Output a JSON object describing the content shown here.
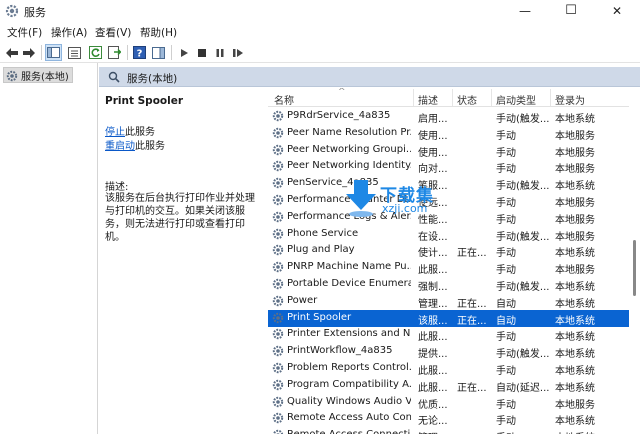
{
  "window": {
    "title": "服务",
    "minimize": "—",
    "maximize": "☐",
    "close": "✕"
  },
  "menu": [
    "文件(F)",
    "操作(A)",
    "查看(V)",
    "帮助(H)"
  ],
  "toolbar_icons": [
    "back-arrow-icon",
    "forward-arrow-icon",
    "show-console-tree-icon",
    "properties-icon",
    "refresh-icon",
    "export-list-icon",
    "help-icon",
    "show-action-pane-icon",
    "start-service-icon",
    "stop-service-icon",
    "pause-service-icon",
    "restart-service-icon"
  ],
  "tree": {
    "root_label": "服务(本地)"
  },
  "pane_header": {
    "title": "服务(本地)"
  },
  "details": {
    "service_name": "Print Spooler",
    "stop_link": "停止",
    "stop_suffix": "此服务",
    "restart_link": "重启动",
    "restart_suffix": "此服务",
    "desc_label": "描述:",
    "description": "该服务在后台执行打印作业并处理与打印机的交互。如果关闭该服务，则无法进行打印或查看打印机。"
  },
  "columns": {
    "name": "名称",
    "desc": "描述",
    "status": "状态",
    "startup": "启动类型",
    "logon": "登录为"
  },
  "services": [
    {
      "name": "P9RdrService_4a835",
      "desc": "启用...",
      "status": "",
      "startup": "手动(触发...",
      "logon": "本地系统"
    },
    {
      "name": "Peer Name Resolution Pr...",
      "desc": "使用...",
      "status": "",
      "startup": "手动",
      "logon": "本地服务"
    },
    {
      "name": "Peer Networking Groupi...",
      "desc": "使用...",
      "status": "",
      "startup": "手动",
      "logon": "本地服务"
    },
    {
      "name": "Peer Networking Identity...",
      "desc": "向对...",
      "status": "",
      "startup": "手动",
      "logon": "本地服务"
    },
    {
      "name": "PenService_4a835",
      "desc": "笔服...",
      "status": "",
      "startup": "手动(触发...",
      "logon": "本地系统"
    },
    {
      "name": "Performance Counter DLL...",
      "desc": "使远...",
      "status": "",
      "startup": "手动",
      "logon": "本地服务"
    },
    {
      "name": "Performance Logs & Aler...",
      "desc": "性能...",
      "status": "",
      "startup": "手动",
      "logon": "本地服务"
    },
    {
      "name": "Phone Service",
      "desc": "在设...",
      "status": "",
      "startup": "手动(触发...",
      "logon": "本地服务"
    },
    {
      "name": "Plug and Play",
      "desc": "使计...",
      "status": "正在...",
      "startup": "手动",
      "logon": "本地系统"
    },
    {
      "name": "PNRP Machine Name Pu...",
      "desc": "此服...",
      "status": "",
      "startup": "手动",
      "logon": "本地服务"
    },
    {
      "name": "Portable Device Enumera...",
      "desc": "强制...",
      "status": "",
      "startup": "手动(触发...",
      "logon": "本地系统"
    },
    {
      "name": "Power",
      "desc": "管理...",
      "status": "正在...",
      "startup": "自动",
      "logon": "本地系统"
    },
    {
      "name": "Print Spooler",
      "desc": "该服...",
      "status": "正在...",
      "startup": "自动",
      "logon": "本地系统",
      "selected": true
    },
    {
      "name": "Printer Extensions and N...",
      "desc": "此服...",
      "status": "",
      "startup": "手动",
      "logon": "本地系统"
    },
    {
      "name": "PrintWorkflow_4a835",
      "desc": "提供...",
      "status": "",
      "startup": "手动(触发...",
      "logon": "本地系统"
    },
    {
      "name": "Problem Reports Control...",
      "desc": "此服...",
      "status": "",
      "startup": "手动",
      "logon": "本地系统"
    },
    {
      "name": "Program Compatibility A...",
      "desc": "此服...",
      "status": "正在...",
      "startup": "自动(延迟...",
      "logon": "本地系统"
    },
    {
      "name": "Quality Windows Audio V...",
      "desc": "优质...",
      "status": "",
      "startup": "手动",
      "logon": "本地服务"
    },
    {
      "name": "Remote Access Auto Con...",
      "desc": "无论...",
      "status": "",
      "startup": "手动",
      "logon": "本地系统"
    },
    {
      "name": "Remote Access Connecti...",
      "desc": "管理...",
      "status": "",
      "startup": "手动",
      "logon": "本地系统"
    }
  ],
  "watermark": {
    "text": "下载集",
    "url": "xzji.com"
  },
  "colors": {
    "selection": "#0a64d2",
    "header_bg": "#cfd9e8",
    "link": "#0a58c8"
  }
}
